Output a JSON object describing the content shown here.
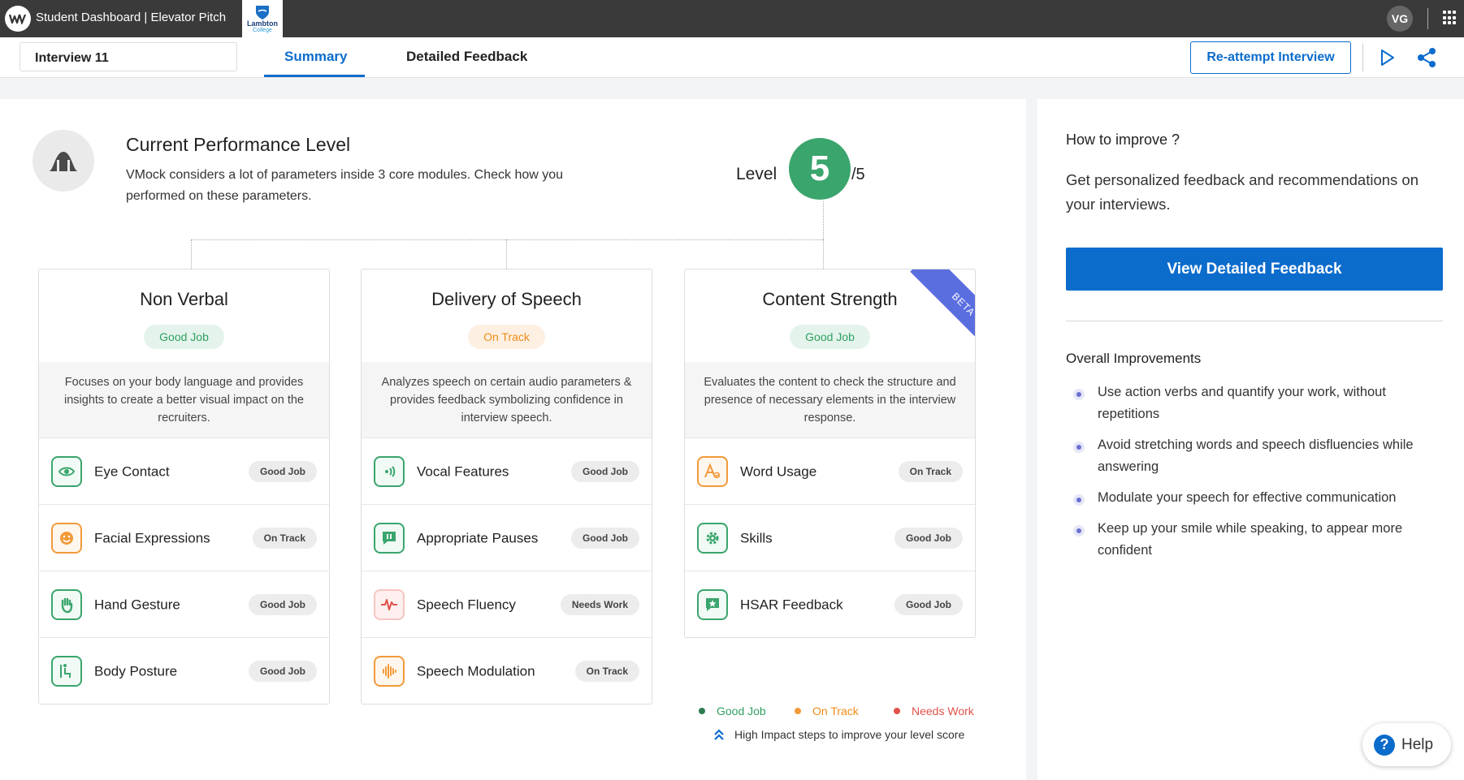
{
  "topbar": {
    "title": "Student Dashboard | Elevator Pitch",
    "college_name": "Lambton",
    "college_sub": "College",
    "user_initials": "VG"
  },
  "subheader": {
    "interview_name": "Interview 11",
    "tabs": [
      {
        "label": "Summary",
        "active": true
      },
      {
        "label": "Detailed Feedback",
        "active": false
      }
    ],
    "reattempt_label": "Re-attempt Interview"
  },
  "performance": {
    "title": "Current Performance Level",
    "description": "VMock considers a lot of parameters inside 3 core modules. Check how you performed on these parameters.",
    "level_label": "Level",
    "level_value": "5",
    "level_max": "/5"
  },
  "modules": [
    {
      "title": "Non Verbal",
      "status": "Good Job",
      "description": "Focuses on your body language and provides insights to create a better visual impact on the recruiters.",
      "params": [
        {
          "name": "Eye Contact",
          "status": "Good Job",
          "icon": "eye-icon"
        },
        {
          "name": "Facial Expressions",
          "status": "On Track",
          "icon": "smile-icon"
        },
        {
          "name": "Hand Gesture",
          "status": "Good Job",
          "icon": "hand-icon"
        },
        {
          "name": "Body Posture",
          "status": "Good Job",
          "icon": "posture-icon"
        }
      ]
    },
    {
      "title": "Delivery of Speech",
      "status": "On Track",
      "description": "Analyzes speech on certain audio parameters & provides feedback symbolizing confidence in interview speech.",
      "params": [
        {
          "name": "Vocal Features",
          "status": "Good Job",
          "icon": "sound-icon"
        },
        {
          "name": "Appropriate Pauses",
          "status": "Good Job",
          "icon": "pause-icon"
        },
        {
          "name": "Speech Fluency",
          "status": "Needs Work",
          "icon": "waveform-icon"
        },
        {
          "name": "Speech Modulation",
          "status": "On Track",
          "icon": "modulation-icon"
        }
      ]
    },
    {
      "title": "Content Strength",
      "status": "Good Job",
      "ribbon": "BETA",
      "description": "Evaluates the content to check the structure and presence of necessary elements in the interview response.",
      "params": [
        {
          "name": "Word Usage",
          "status": "On Track",
          "icon": "text-icon"
        },
        {
          "name": "Skills",
          "status": "Good Job",
          "icon": "gear-icon"
        },
        {
          "name": "HSAR Feedback",
          "status": "Good Job",
          "icon": "star-icon"
        }
      ]
    }
  ],
  "legend": {
    "good": "Good Job",
    "track": "On Track",
    "needs": "Needs Work",
    "high_impact": "High Impact steps to improve your level score"
  },
  "right_panel": {
    "title": "How to improve ?",
    "description": "Get personalized feedback and recommendations on your interviews.",
    "button_label": "View Detailed Feedback",
    "overall_title": "Overall Improvements",
    "improvements": [
      "Use action verbs and quantify your work, without repetitions",
      "Avoid stretching words and speech disfluencies while answering",
      "Modulate your speech for effective communication",
      "Keep up your smile while speaking, to appear more confident"
    ]
  },
  "help_label": "Help",
  "colors": {
    "primary": "#0c6ccc",
    "good": "#3aa56d",
    "track": "#ef8b19",
    "needs": "#e0524a"
  }
}
